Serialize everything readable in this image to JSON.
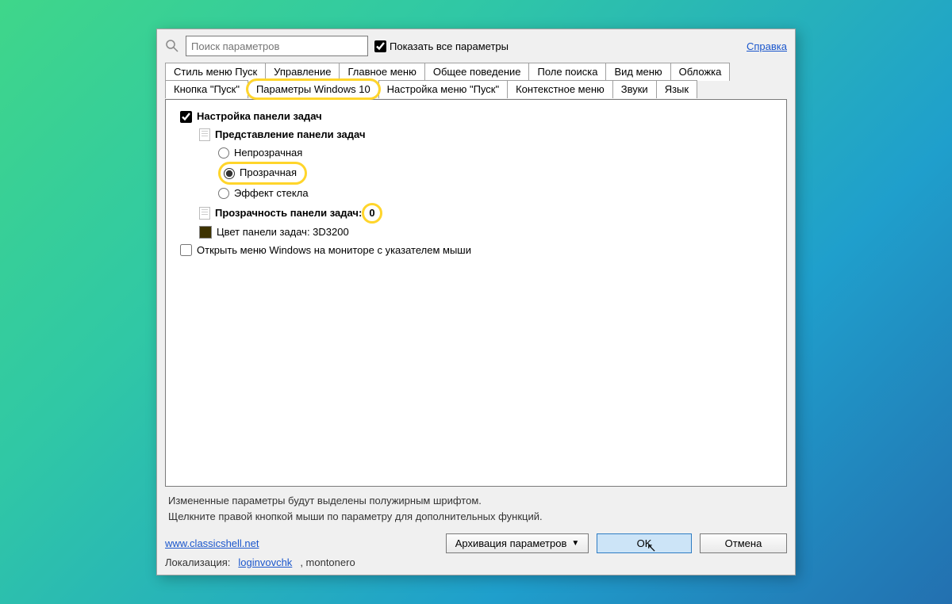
{
  "topRow": {
    "searchPlaceholder": "Поиск параметров",
    "showAllLabel": "Показать все параметры",
    "helpLink": "Справка"
  },
  "tabs": {
    "row1": [
      "Стиль меню Пуск",
      "Управление",
      "Главное меню",
      "Общее поведение",
      "Поле поиска",
      "Вид меню",
      "Обложка"
    ],
    "row2": [
      "Кнопка \"Пуск\"",
      "Параметры Windows 10",
      "Настройка меню \"Пуск\"",
      "Контекстное меню",
      "Звуки",
      "Язык"
    ],
    "activeTab": "Параметры Windows 10"
  },
  "settings": {
    "taskbarSetup": "Настройка панели задач",
    "taskbarView": "Представление панели задач",
    "radioOpaque": "Непрозрачная",
    "radioTransparent": "Прозрачная",
    "radioGlass": "Эффект стекла",
    "opacityLabel": "Прозрачность панели задач",
    "opacityValue": "0",
    "colorLabel": "Цвет панели задач: 3D3200",
    "openOnMonitor": "Открыть меню Windows на мониторе с указателем мыши"
  },
  "hint": {
    "line1": "Измененные параметры будут выделены полужирным шрифтом.",
    "line2": "Щелкните правой кнопкой мыши по параметру для дополнительных функций."
  },
  "footer": {
    "siteLink": "www.classicshell.net",
    "backupBtn": "Архивация параметров",
    "okBtn": "OK",
    "cancelBtn": "Отмена",
    "locLabel": "Локализация:",
    "locAuthor": "loginvovchk",
    "locAuthor2": ", montonero"
  }
}
